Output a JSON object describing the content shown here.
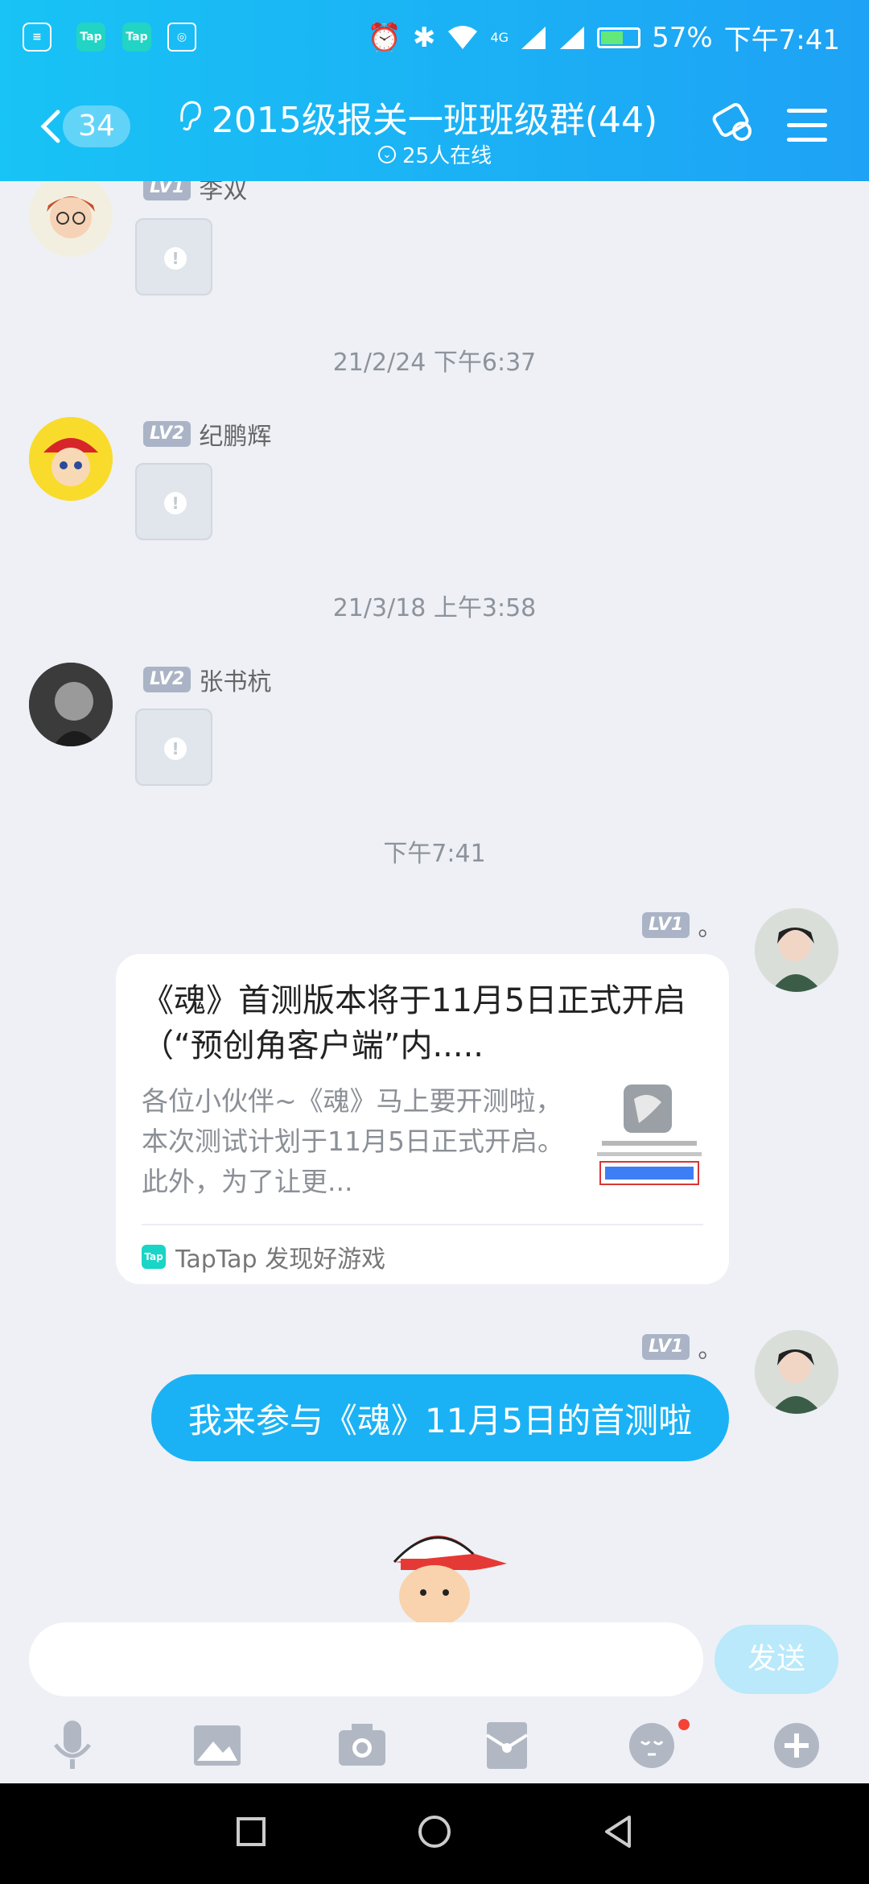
{
  "status_bar": {
    "app_icons": [
      "Tap",
      "Tap"
    ],
    "network": "4G",
    "battery": "57%",
    "time": "下午7:41"
  },
  "header": {
    "unread_count": "34",
    "title": "2015级报关一班班级群(44)",
    "online": "25人在线"
  },
  "messages": [
    {
      "level": "LV1",
      "sender": "李双",
      "content": "image-failed"
    },
    {
      "time": "21/2/24 下午6:37"
    },
    {
      "level": "LV2",
      "sender": "纪鹏辉",
      "content": "image-failed"
    },
    {
      "time": "21/3/18 上午3:58"
    },
    {
      "level": "LV2",
      "sender": "张书杭",
      "content": "image-failed"
    },
    {
      "time": "下午7:41"
    }
  ],
  "card": {
    "level": "LV1",
    "sender": "。",
    "title": "《魂》首测版本将于11月5日正式开启（“预创角客户端”内.....",
    "desc": "各位小伙伴~《魂》马上要开测啦，本次测试计划于11月5日正式开启。此外，为了让更...",
    "source": "TapTap 发现好游戏"
  },
  "bubble": {
    "level": "LV1",
    "sender": "。",
    "text": "我来参与《魂》11月5日的首测啦"
  },
  "input": {
    "placeholder": "",
    "send_label": "发送"
  },
  "toolbar_icons": [
    "microphone-icon",
    "image-icon",
    "camera-icon",
    "red-packet-icon",
    "emoji-icon",
    "plus-icon"
  ]
}
